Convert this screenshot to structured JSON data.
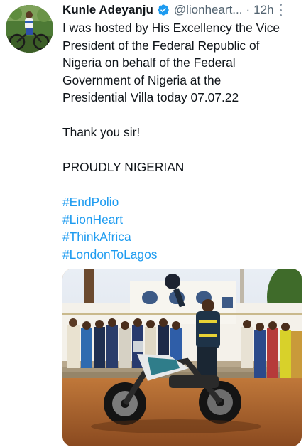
{
  "tweet": {
    "author_name": "Kunle Adeyanju",
    "handle": "@lionheart...",
    "separator": "·",
    "time": "12h",
    "lines": [
      "I was hosted by His Excellency the Vice",
      "President of the Federal Republic of",
      "Nigeria on behalf of the Federal",
      "Government of Nigeria at the",
      "Presidential Villa today 07.07.22"
    ],
    "thanks": "Thank you sir!",
    "proud": "PROUDLY NIGERIAN",
    "hashtags": [
      "#EndPolio",
      "#LionHeart",
      "#ThinkAfrica",
      "#LondonToLagos"
    ]
  },
  "colors": {
    "hashtag": "#1d9bf0",
    "verified_badge": "#1d9bf0",
    "secondary_text": "#536471"
  },
  "icons": {
    "verified": "verified-badge-icon",
    "more": "more-options-icon"
  }
}
